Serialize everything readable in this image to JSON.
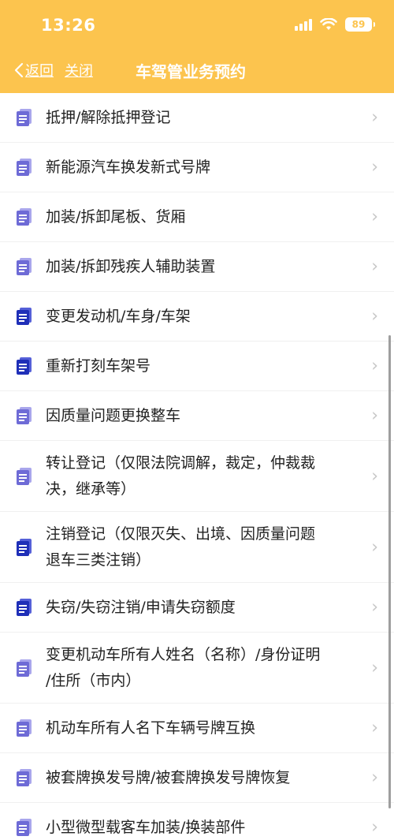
{
  "status": {
    "time": "13:26",
    "battery": "89"
  },
  "nav": {
    "back_label": "返回",
    "close_label": "关闭",
    "title": "车驾管业务预约"
  },
  "colors": {
    "header": "#FCC44E",
    "icon_light": "#6E6BD6",
    "icon_dark": "#1F2FB8"
  },
  "items": [
    {
      "label": "抵押/解除抵押登记"
    },
    {
      "label": "新能源汽车换发新式号牌"
    },
    {
      "label": "加装/拆卸尾板、货厢"
    },
    {
      "label": "加装/拆卸残疾人辅助装置"
    },
    {
      "label": "变更发动机/车身/车架"
    },
    {
      "label": "重新打刻车架号"
    },
    {
      "label": "因质量问题更换整车"
    },
    {
      "label_line1": "转让登记（仅限法院调解，裁定，仲裁裁",
      "label_line2": "决，继承等）"
    },
    {
      "label_line1": "注销登记（仅限灭失、出境、因质量问题",
      "label_line2": "退车三类注销）"
    },
    {
      "label": "失窃/失窃注销/申请失窃额度"
    },
    {
      "label_line1": "变更机动车所有人姓名（名称）/身份证明",
      "label_line2": "/住所（市内）"
    },
    {
      "label": "机动车所有人名下车辆号牌互换"
    },
    {
      "label": "被套牌换发号牌/被套牌换发号牌恢复"
    },
    {
      "label": "小型微型载客车加装/换装部件"
    }
  ]
}
